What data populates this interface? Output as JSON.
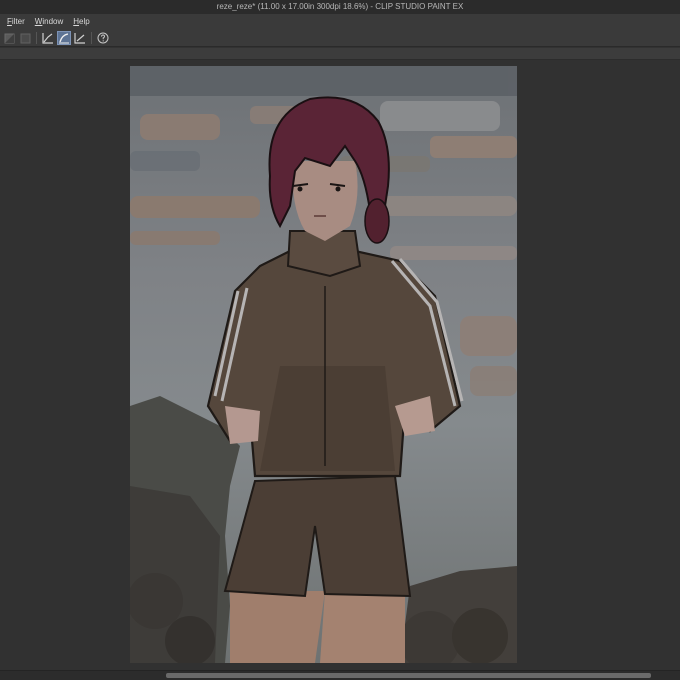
{
  "window": {
    "title": "reze_reze* (11.00 x 17.00in 300dpi 18.6%)  - CLIP STUDIO PAINT EX"
  },
  "menubar": {
    "items": [
      {
        "label_ul": "F",
        "label_rest": "ilter"
      },
      {
        "label_ul": "W",
        "label_rest": "indow"
      },
      {
        "label_ul": "H",
        "label_rest": "elp"
      }
    ]
  },
  "toolbar": {
    "buttons": [
      {
        "icon": "layer-mask-icon",
        "state": "disabled"
      },
      {
        "icon": "layer-square-icon",
        "state": "disabled"
      },
      {
        "icon": "ruler-edit-icon",
        "state": "normal"
      },
      {
        "icon": "vector-curve-icon",
        "state": "active"
      },
      {
        "icon": "vector-line-icon",
        "state": "normal"
      },
      {
        "icon": "help-icon",
        "state": "normal"
      }
    ]
  },
  "canvas": {
    "image": "painting of a girl with dark red hair in a brown turtleneck sweater and shorts against a cloudy grey sky"
  },
  "colors": {
    "app_bg": "#323232",
    "active_tool": "#5d7394",
    "hair": "#5a2436",
    "sweater": "#55473c",
    "sky": "#7d8287"
  }
}
